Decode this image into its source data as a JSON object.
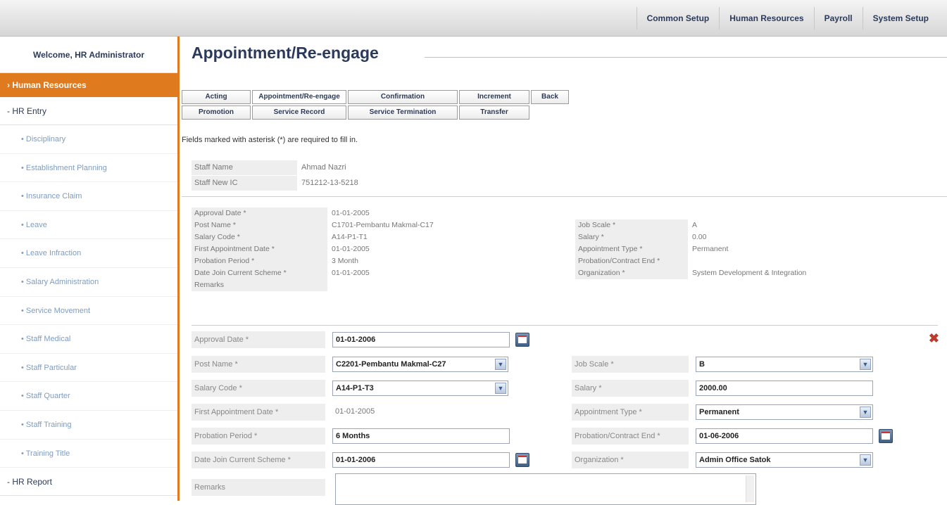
{
  "top_nav": [
    "Common Setup",
    "Human Resources",
    "Payroll",
    "System Setup"
  ],
  "sidebar": {
    "welcome": "Welcome, HR Administrator",
    "active_section": "Human Resources",
    "entry_header": "- HR Entry",
    "items": [
      "Disciplinary",
      "Establishment Planning",
      "Insurance Claim",
      "Leave",
      "Leave Infraction",
      "Salary Administration",
      "Service Movement",
      "Staff Medical",
      "Staff Particular",
      "Staff Quarter",
      "Staff Training",
      "Training Title"
    ],
    "report_header": "- HR Report"
  },
  "page_title": "Appointment/Re-engage",
  "tabs_row1": [
    "Acting",
    "Appointment/Re-engage",
    "Confirmation",
    "Increment",
    "Back"
  ],
  "tabs_row2": [
    "Promotion",
    "Service Record",
    "Service Termination",
    "Transfer"
  ],
  "required_note": "Fields marked with asterisk (*) are required to fill in.",
  "staff": {
    "name_label": "Staff Name",
    "name_value": "Ahmad Nazri",
    "ic_label": "Staff New IC",
    "ic_value": "751212-13-5218"
  },
  "read": {
    "approval_date_label": "Approval Date *",
    "approval_date": "01-01-2005",
    "post_name_label": "Post Name *",
    "post_name": "C1701-Pembantu Makmal-C17",
    "job_scale_label": "Job Scale *",
    "job_scale": "A",
    "salary_code_label": "Salary Code *",
    "salary_code": "A14-P1-T1",
    "salary_label": "Salary *",
    "salary": "0.00",
    "first_appt_label": "First Appointment Date *",
    "first_appt": "01-01-2005",
    "appt_type_label": "Appointment Type *",
    "appt_type": "Permanent",
    "probation_label": "Probation Period *",
    "probation": "3 Month",
    "prob_end_label": "Probation/Contract End *",
    "prob_end": "",
    "date_join_label": "Date Join Current Scheme *",
    "date_join": "01-01-2005",
    "org_label": "Organization *",
    "org": "System Development & Integration",
    "remarks_label": "Remarks"
  },
  "edit": {
    "approval_date_label": "Approval Date *",
    "approval_date": "01-01-2006",
    "post_name_label": "Post Name *",
    "post_name": "C2201-Pembantu Makmal-C27",
    "job_scale_label": "Job Scale *",
    "job_scale": "B",
    "salary_code_label": "Salary Code *",
    "salary_code": "A14-P1-T3",
    "salary_label": "Salary *",
    "salary": "2000.00",
    "first_appt_label": "First Appointment Date *",
    "first_appt": "01-01-2005",
    "appt_type_label": "Appointment Type *",
    "appt_type": "Permanent",
    "probation_label": "Probation Period *",
    "probation": "6 Months",
    "prob_end_label": "Probation/Contract End *",
    "prob_end": "01-06-2006",
    "date_join_label": "Date Join Current Scheme *",
    "date_join": "01-01-2006",
    "org_label": "Organization *",
    "org": "Admin Office Satok",
    "remarks_label": "Remarks"
  }
}
